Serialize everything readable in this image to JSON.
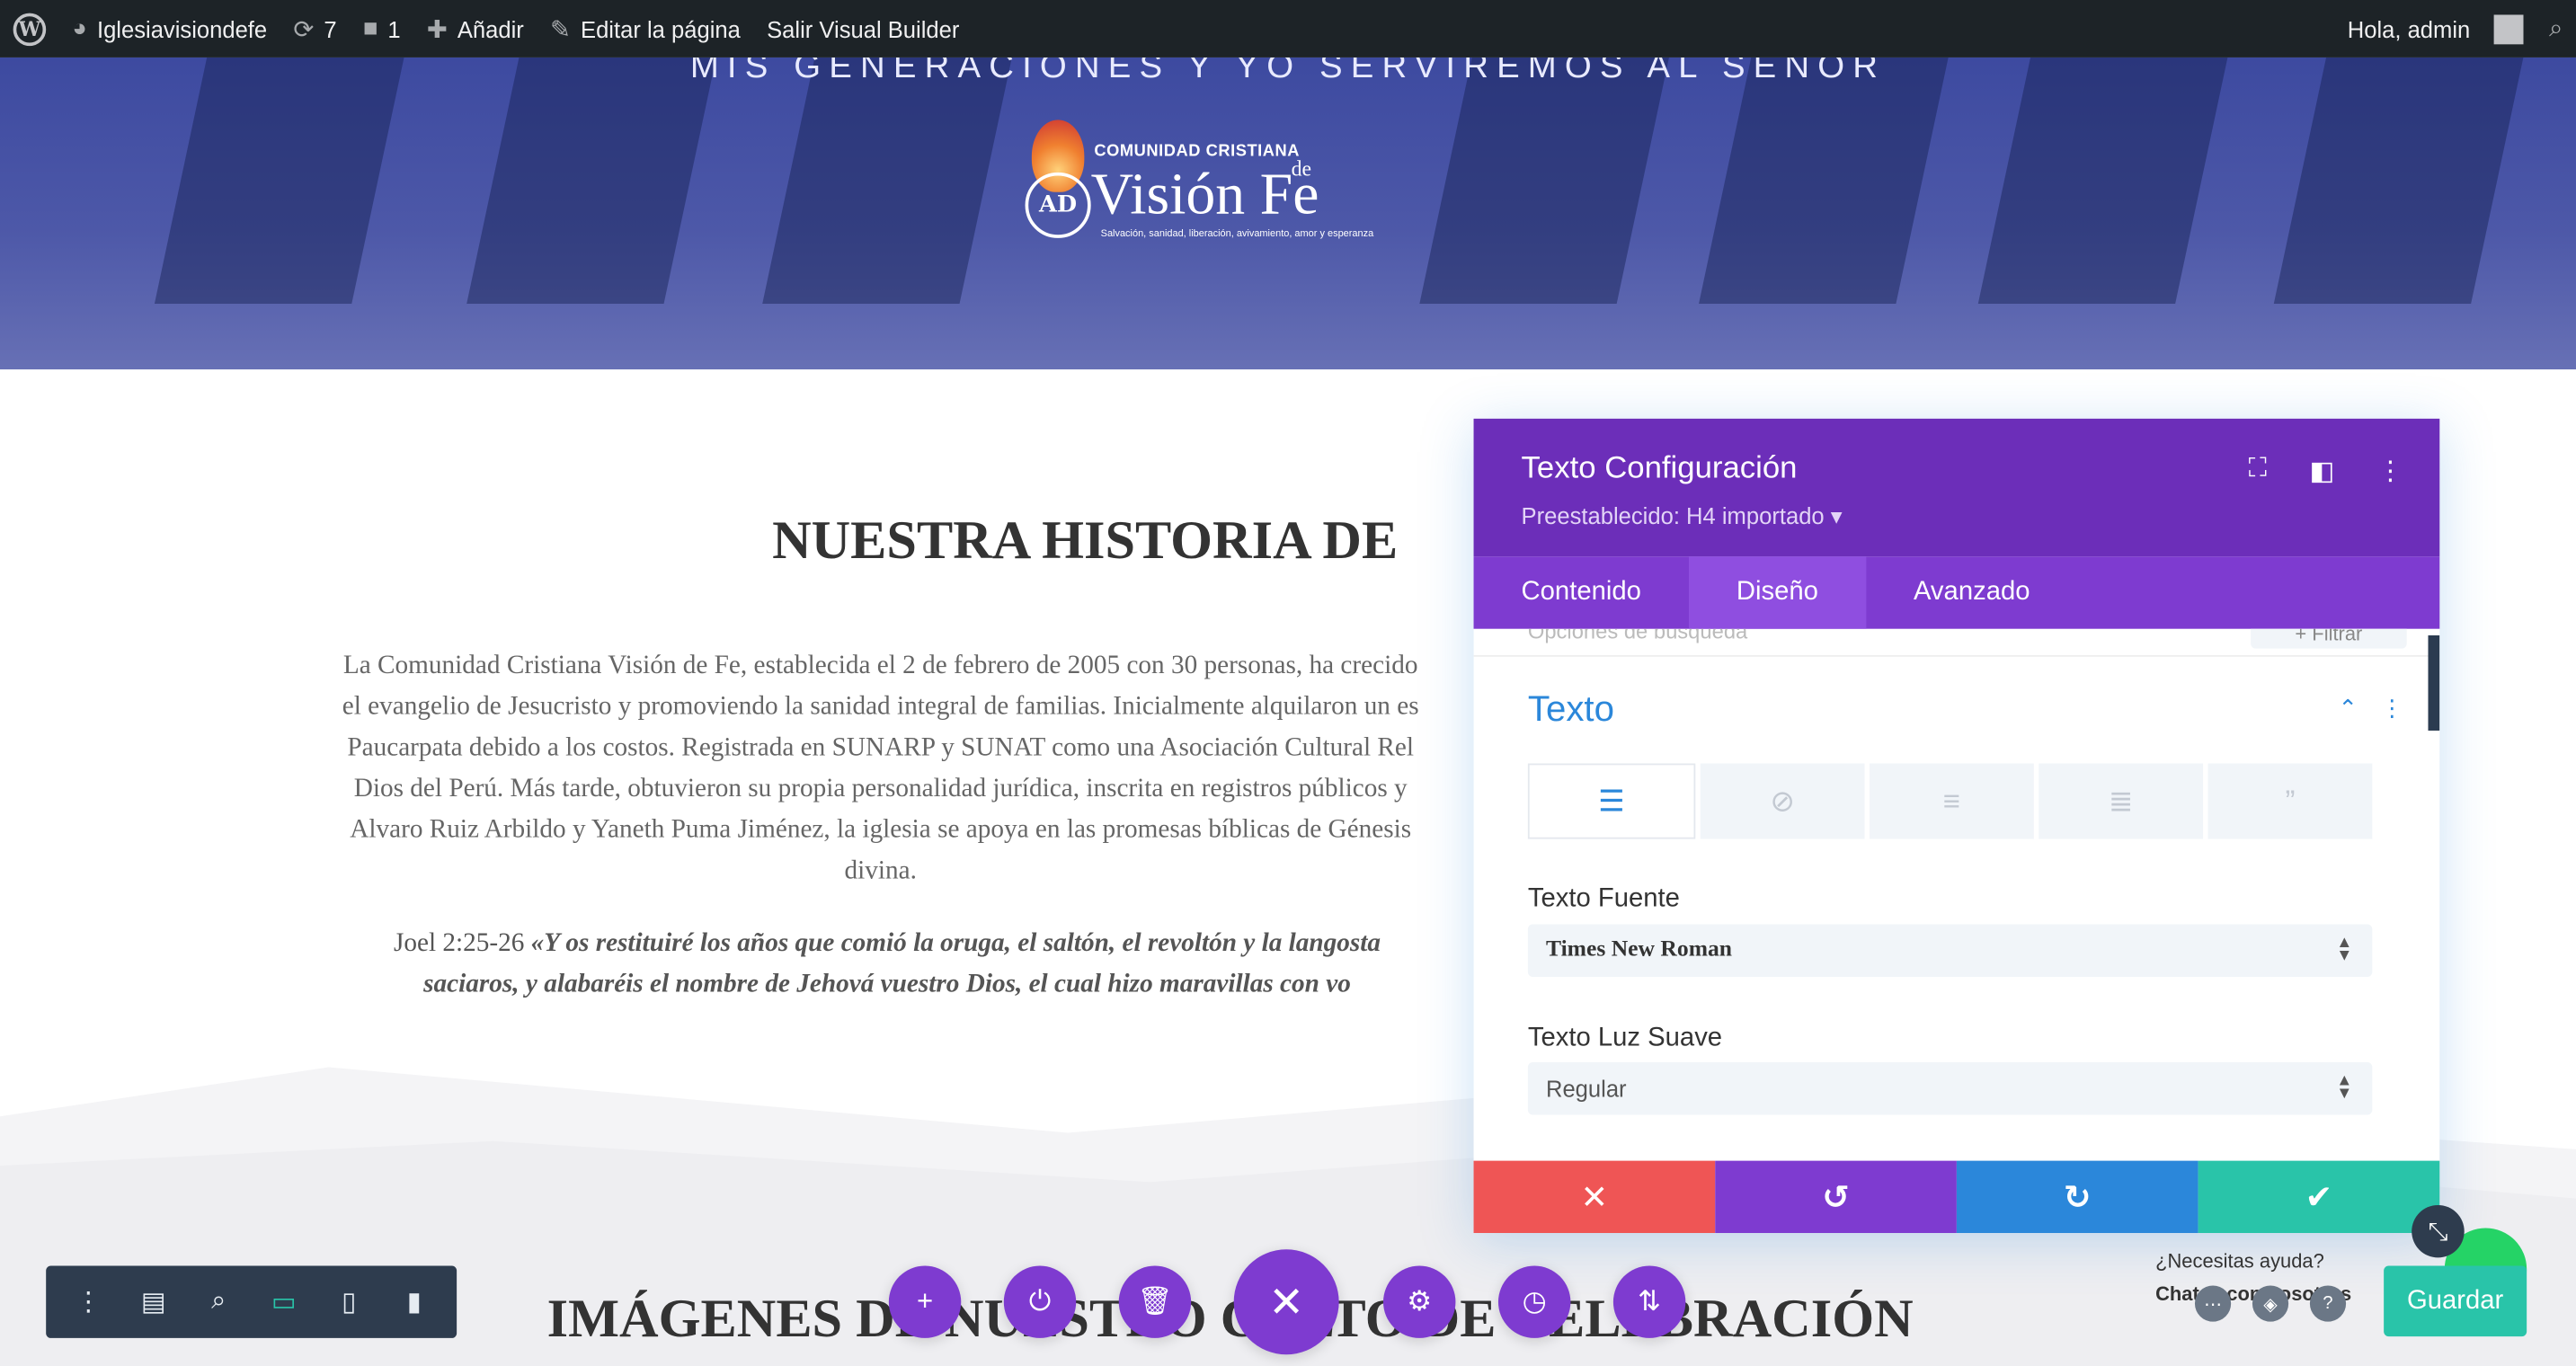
{
  "admin_bar": {
    "site_name": "Iglesiavisiondefe",
    "updates_count": "7",
    "comments_count": "1",
    "add_label": "Añadir",
    "edit_page_label": "Editar la página",
    "exit_builder_label": "Salir Visual Builder",
    "greeting": "Hola, admin"
  },
  "hero": {
    "tagline": "MIS GENERACIONES Y YO SERVIREMOS AL SEÑOR",
    "logo_top": "COMUNIDAD CRISTIANA",
    "logo_main": "Visión",
    "logo_de": "de",
    "logo_fe": "Fe",
    "logo_seal": "AD",
    "logo_slogan": "Salvación, sanidad, liberación, avivamiento, amor y esperanza"
  },
  "content": {
    "title": "NUESTRA HISTORIA DE",
    "paragraph_lines": [
      "La Comunidad Cristiana Visión de Fe, establecida el 2 de febrero de 2005 con 30 personas, ha crecido",
      "el evangelio de Jesucristo y promoviendo la sanidad integral de familias. Inicialmente alquilaron un es",
      "Paucarpata debido a los costos. Registrada en SUNARP y SUNAT como una Asociación Cultural Rel",
      "Dios del Perú. Más tarde, obtuvieron su propia personalidad jurídica, inscrita en registros públicos y",
      "Alvaro Ruiz Arbildo y Yaneth Puma Jiménez, la iglesia se apoya en las promesas bíblicas de Génesis",
      "divina."
    ],
    "verse_ref": "Joel  2:25-26 ",
    "verse_line1": "«Y os restituiré los años que comió la oruga,  el  saltón,  el  revoltón  y  la  langosta",
    "verse_line2": "saciaros, y alabaréis el nombre de Jehová vuestro Dios, el cual hizo maravillas con vo",
    "bottom_title": "IMÁGENES DE NUESTRO CULTO DE CELEBRACIÓN"
  },
  "modal": {
    "title": "Texto Configuración",
    "preset": "Preestablecido: H4 importado",
    "tabs": [
      "Contenido",
      "Diseño",
      "Avanzado"
    ],
    "active_tab": "Diseño",
    "search_ghost": "Opciones de búsqueda",
    "filter_label": "+ Filtrar",
    "section_title": "Texto",
    "font_label": "Texto Fuente",
    "font_value": "Times New Roman",
    "weight_label": "Texto Luz Suave",
    "weight_value": "Regular"
  },
  "help": {
    "question": "¿Necesitas ayuda?",
    "chat": "Chatea con nosotros"
  },
  "save_label": "Guardar",
  "colors": {
    "admin_bar": "#1d2327",
    "modal_header": "#6c2eb9",
    "modal_tabs": "#7e3bd0",
    "accent_blue": "#2b87da",
    "cancel_red": "#ef5555",
    "undo_purple": "#7e3bd0",
    "redo_blue": "#2b87da",
    "confirm_green": "#29c4a9"
  }
}
